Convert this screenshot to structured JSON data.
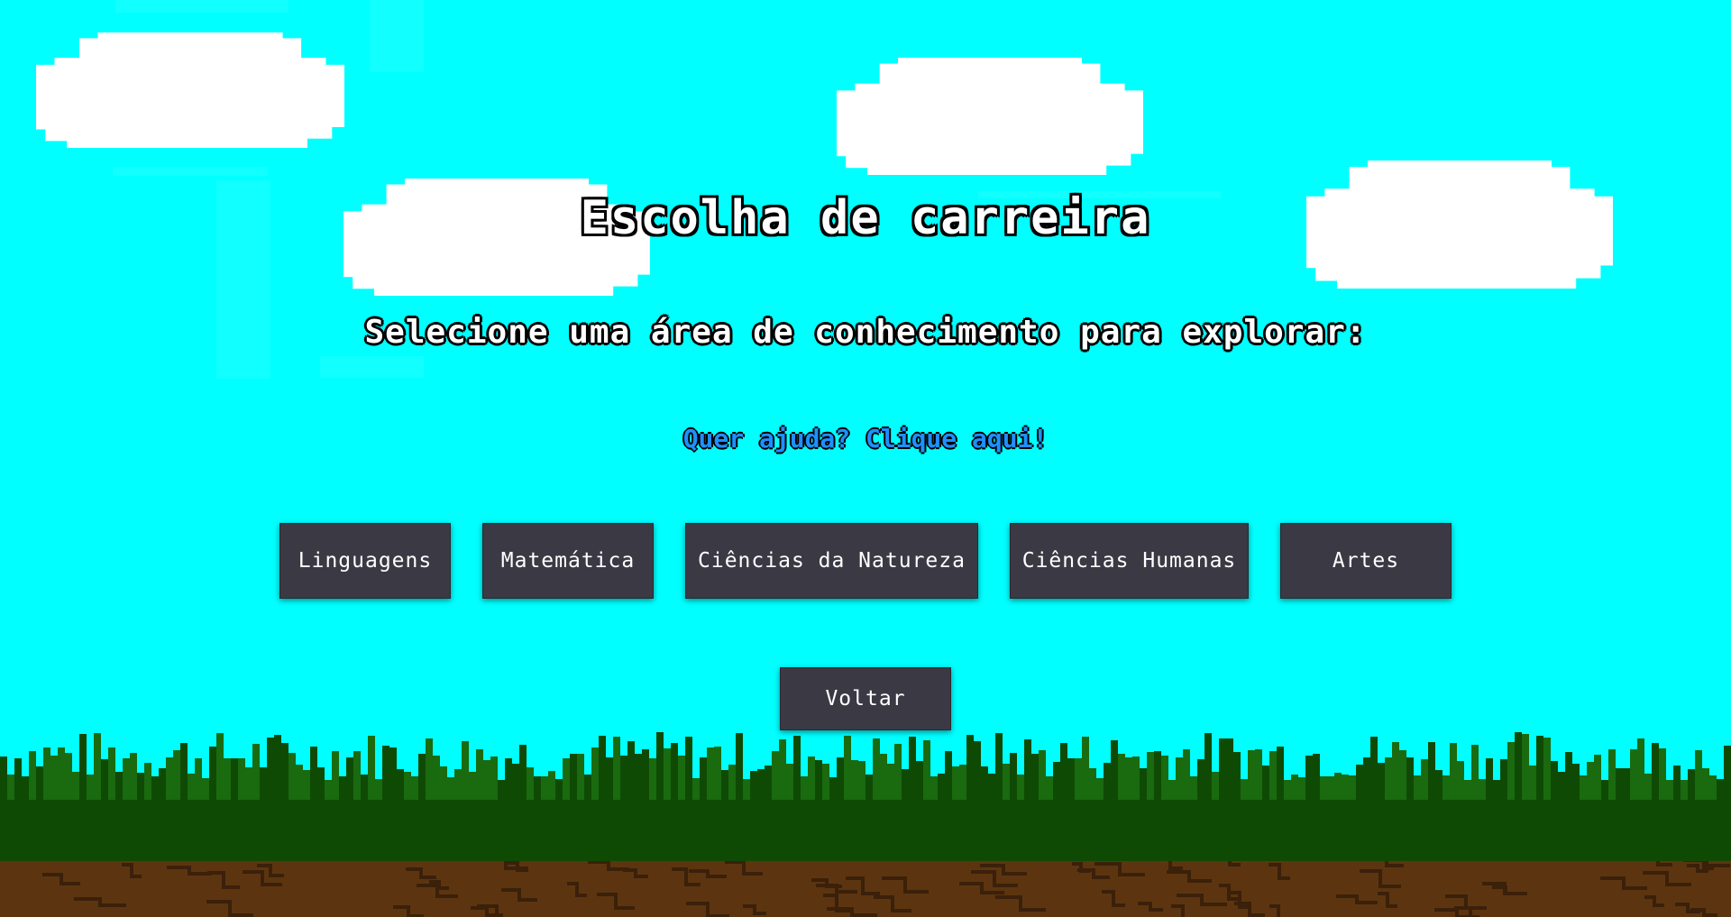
{
  "page": {
    "title": "Escolha de carreira",
    "subtitle": "Selecione uma área de conhecimento para explorar:",
    "help_link": "Quer ajuda? Clique aqui!"
  },
  "areas": [
    {
      "label": "Linguagens"
    },
    {
      "label": "Matemática"
    },
    {
      "label": "Ciências da Natureza"
    },
    {
      "label": "Ciências Humanas"
    },
    {
      "label": "Artes"
    }
  ],
  "back_button": {
    "label": "Voltar"
  },
  "colors": {
    "sky": "#00ffff",
    "cloud": "#ffffff",
    "button": "#3a3944",
    "link": "#1e90ff",
    "grass_dark": "#0f4a05",
    "grass_mid": "#1a6a10",
    "dirt": "#5c3510",
    "dirt_line": "#3b200a"
  }
}
